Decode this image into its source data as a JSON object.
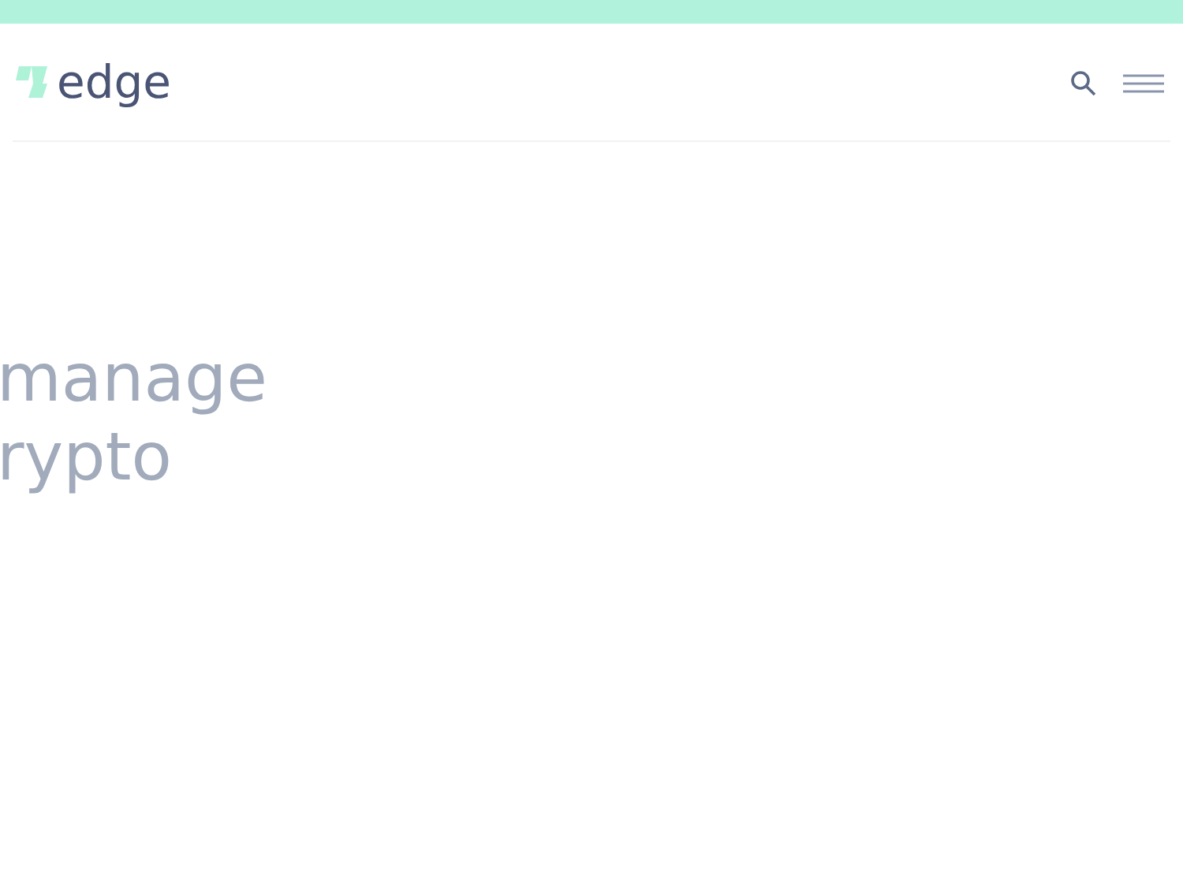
{
  "header": {
    "logo_text": "edge"
  },
  "hero": {
    "lines": [
      "manage",
      "rypto"
    ]
  }
}
